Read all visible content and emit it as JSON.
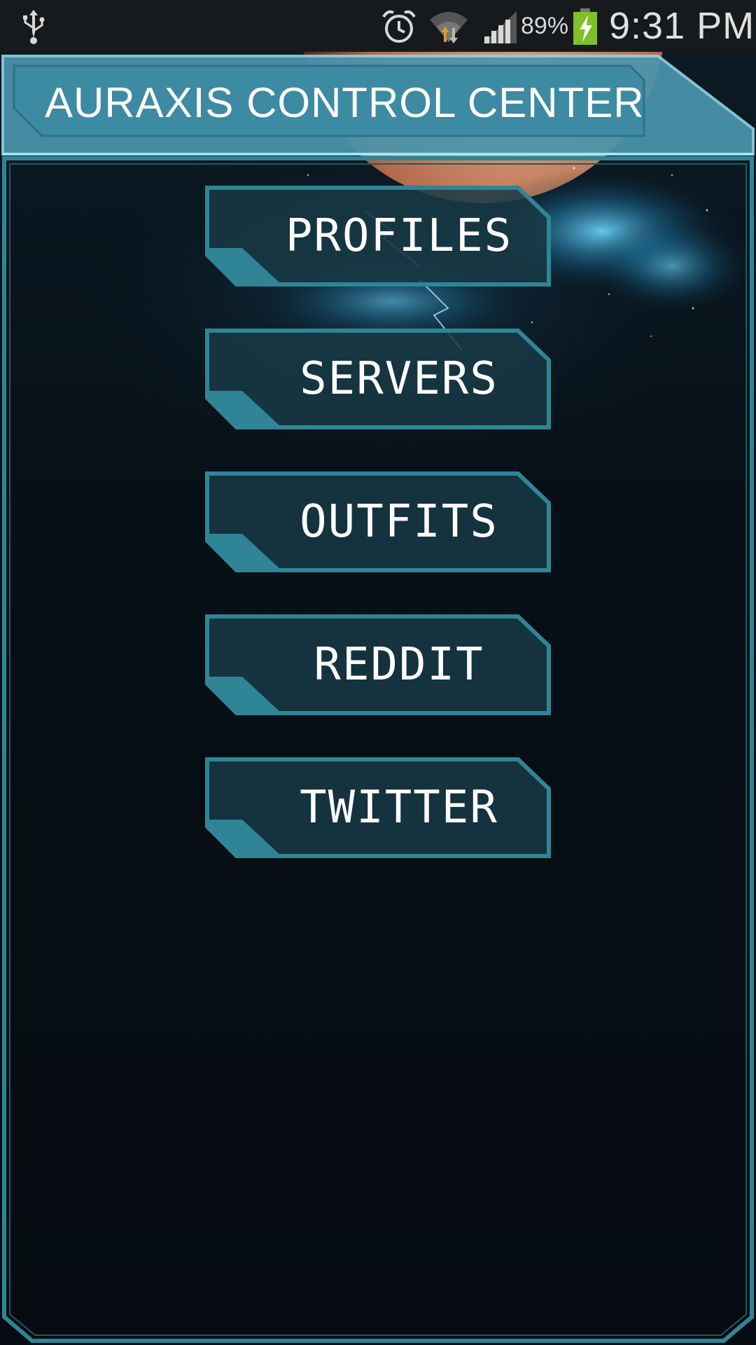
{
  "status_bar": {
    "battery_percent": "89%",
    "time": "9:31 PM",
    "icons": [
      "usb-icon",
      "alarm-icon",
      "wifi-icon",
      "signal-icon",
      "battery-charging-icon"
    ]
  },
  "header": {
    "title": "AURAXIS CONTROL CENTER"
  },
  "menu": {
    "items": [
      {
        "label": "PROFILES"
      },
      {
        "label": "SERVERS"
      },
      {
        "label": "OUTFITS"
      },
      {
        "label": "REDDIT"
      },
      {
        "label": "TWITTER"
      }
    ]
  },
  "colors": {
    "frame": "#2f8596",
    "button_fill": "#173a45",
    "title_fill": "#4a95ad",
    "background": "#050b10"
  }
}
